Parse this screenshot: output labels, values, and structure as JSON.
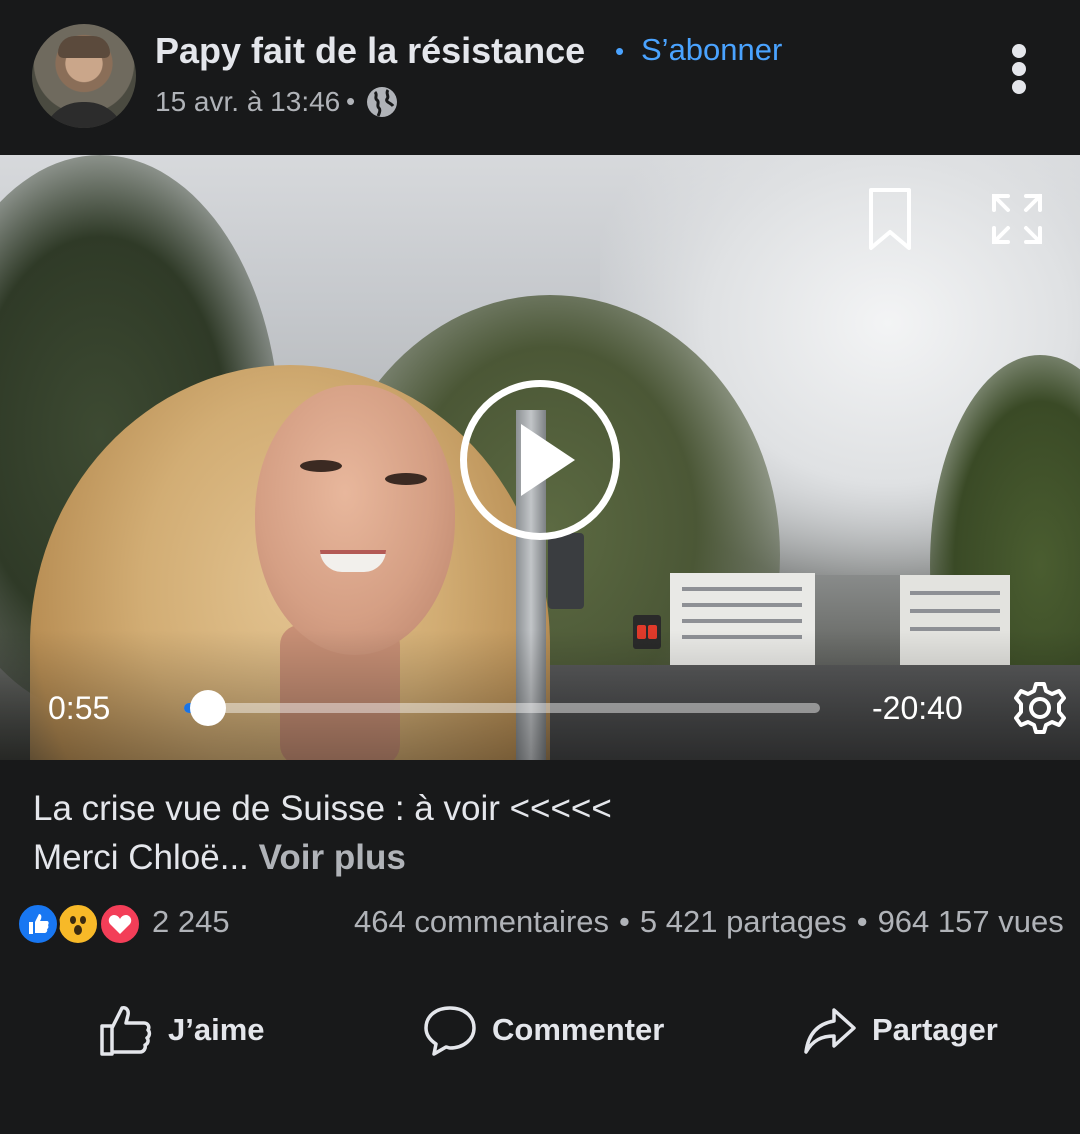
{
  "post": {
    "author": "Papy fait de la résistance",
    "subscribe_label": "S’abonner",
    "separator": "•",
    "timestamp": "15 avr. à 13:46",
    "privacy_icon": "globe-icon",
    "more_icon": "more-options-icon"
  },
  "video": {
    "current_time": "0:55",
    "remaining_time": "-20:40",
    "progress": 0.038,
    "icons": [
      "bookmark-icon",
      "fullscreen-icon",
      "play-icon",
      "settings-icon"
    ]
  },
  "caption": {
    "line1": "La crise vue de Suisse : à voir <<<<<",
    "line2": "Merci Chloë...",
    "see_more": "Voir plus"
  },
  "reactions": {
    "types": [
      "like",
      "wow",
      "love"
    ],
    "count": "2 245",
    "comments": "464 commentaires",
    "shares": "5 421 partages",
    "views": "964 157 vues",
    "separator": "•"
  },
  "actions": {
    "like": "J’aime",
    "comment": "Commenter",
    "share": "Partager"
  },
  "colors": {
    "background": "#18191a",
    "accent": "#4aa3ff",
    "like_blue": "#1877f2",
    "love_red": "#f33e58",
    "wow_yellow": "#f7b928"
  }
}
